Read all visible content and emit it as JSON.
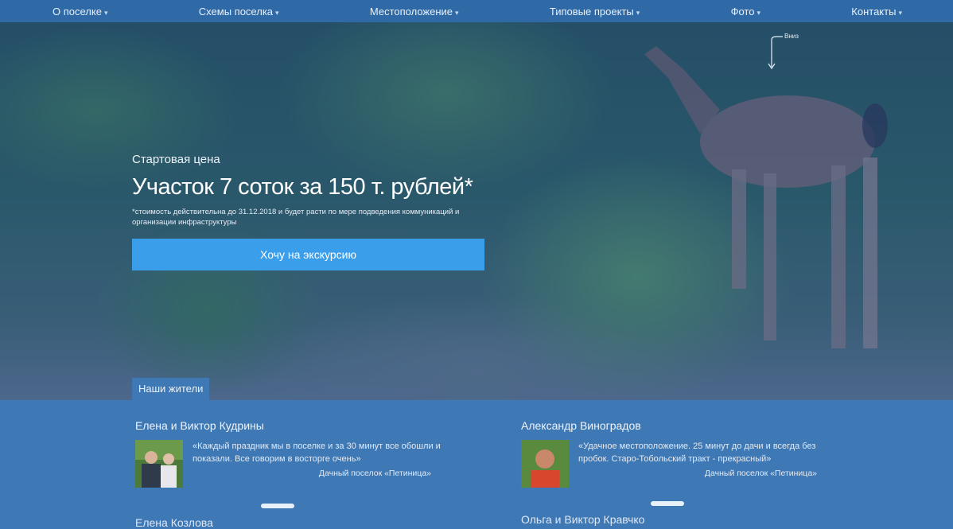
{
  "nav": {
    "items": [
      {
        "label": "О поселке"
      },
      {
        "label": "Схемы поселка"
      },
      {
        "label": "Местоположение"
      },
      {
        "label": "Типовые проекты"
      },
      {
        "label": "Фото"
      },
      {
        "label": "Контакты"
      }
    ]
  },
  "hero": {
    "eyebrow": "Стартовая цена",
    "title": "Участок 7 соток за 150 т. рублей*",
    "note": "*стоимость действительна до 31.12.2018 и будет расти по мере подведения коммуникаций и организации инфраструктуры",
    "cta_label": "Хочу на экскурсию",
    "scroll_label": "Вниз"
  },
  "reviews": {
    "tab_label": "Наши жители",
    "items": [
      {
        "name": "Елена и Виктор Кудрины",
        "quote": "«Каждый праздник мы в поселке и за 30 минут все обошли и показали. Все говорим в восторге очень»",
        "source": "Дачный поселок «Петиница»"
      },
      {
        "name": "Александр Виноградов",
        "quote": "«Удачное местоположение. 25 минут до дачи и всегда без пробок. Старо-Тобольский тракт - прекрасный»",
        "source": "Дачный поселок «Петиница»"
      }
    ],
    "next": [
      "Елена Козлова",
      "Ольга и Виктор Кравчко"
    ]
  }
}
